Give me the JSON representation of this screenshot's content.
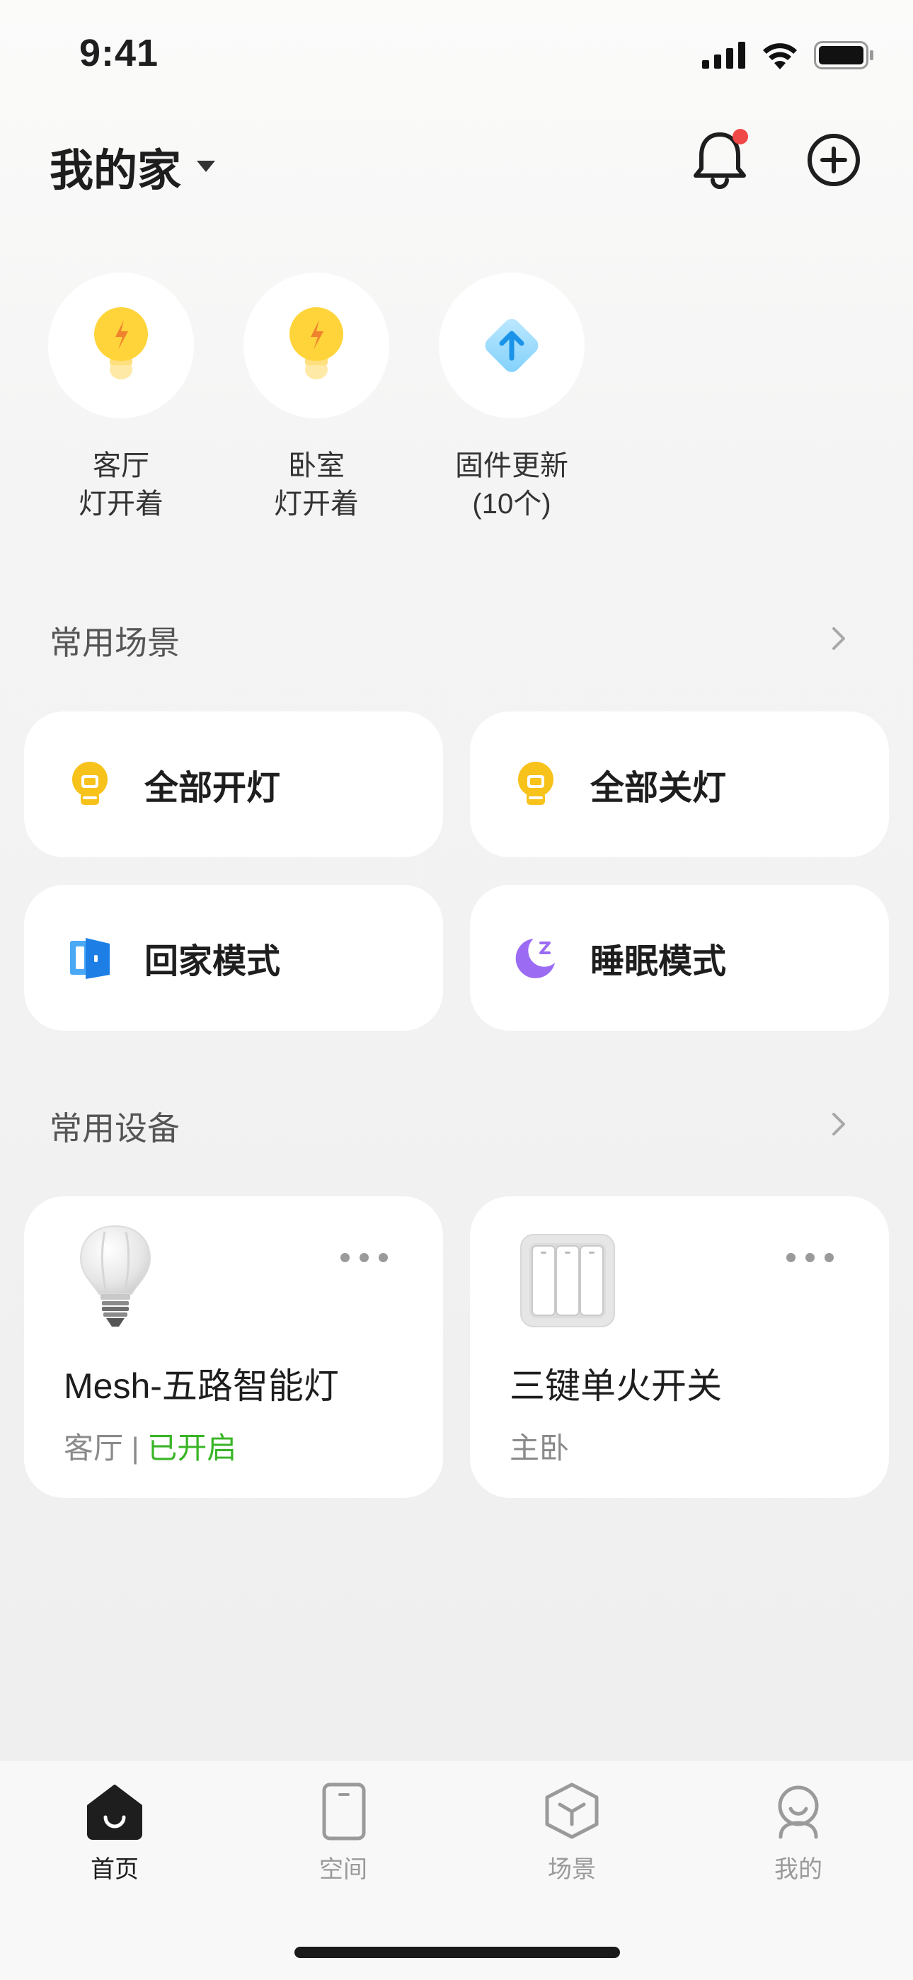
{
  "status_bar": {
    "time": "9:41"
  },
  "header": {
    "home_name": "我的家"
  },
  "quick_status": [
    {
      "line1": "客厅",
      "line2": "灯开着",
      "icon": "bulb-icon"
    },
    {
      "line1": "卧室",
      "line2": "灯开着",
      "icon": "bulb-icon"
    },
    {
      "line1": "固件更新",
      "line2": "(10个)",
      "icon": "firmware-update-icon"
    }
  ],
  "scenes": {
    "title": "常用场景",
    "items": [
      {
        "label": "全部开灯",
        "icon": "light-on-icon",
        "color": "#f5c518"
      },
      {
        "label": "全部关灯",
        "icon": "light-off-icon",
        "color": "#f5c518"
      },
      {
        "label": "回家模式",
        "icon": "door-icon",
        "color": "#2b8ef0"
      },
      {
        "label": "睡眠模式",
        "icon": "moon-icon",
        "color": "#9a6cf0"
      }
    ]
  },
  "devices": {
    "title": "常用设备",
    "items": [
      {
        "name": "Mesh-五路智能灯",
        "room": "客厅",
        "separator": " | ",
        "status": "已开启",
        "icon": "smart-bulb-icon"
      },
      {
        "name": "三键单火开关",
        "room": "主卧",
        "icon": "triple-switch-icon"
      }
    ]
  },
  "tabs": [
    {
      "label": "首页",
      "icon": "home-icon",
      "active": true
    },
    {
      "label": "空间",
      "icon": "space-icon",
      "active": false
    },
    {
      "label": "场景",
      "icon": "scene-icon",
      "active": false
    },
    {
      "label": "我的",
      "icon": "profile-icon",
      "active": false
    }
  ],
  "colors": {
    "accent_green": "#39b526",
    "notification_dot": "#f04848"
  }
}
